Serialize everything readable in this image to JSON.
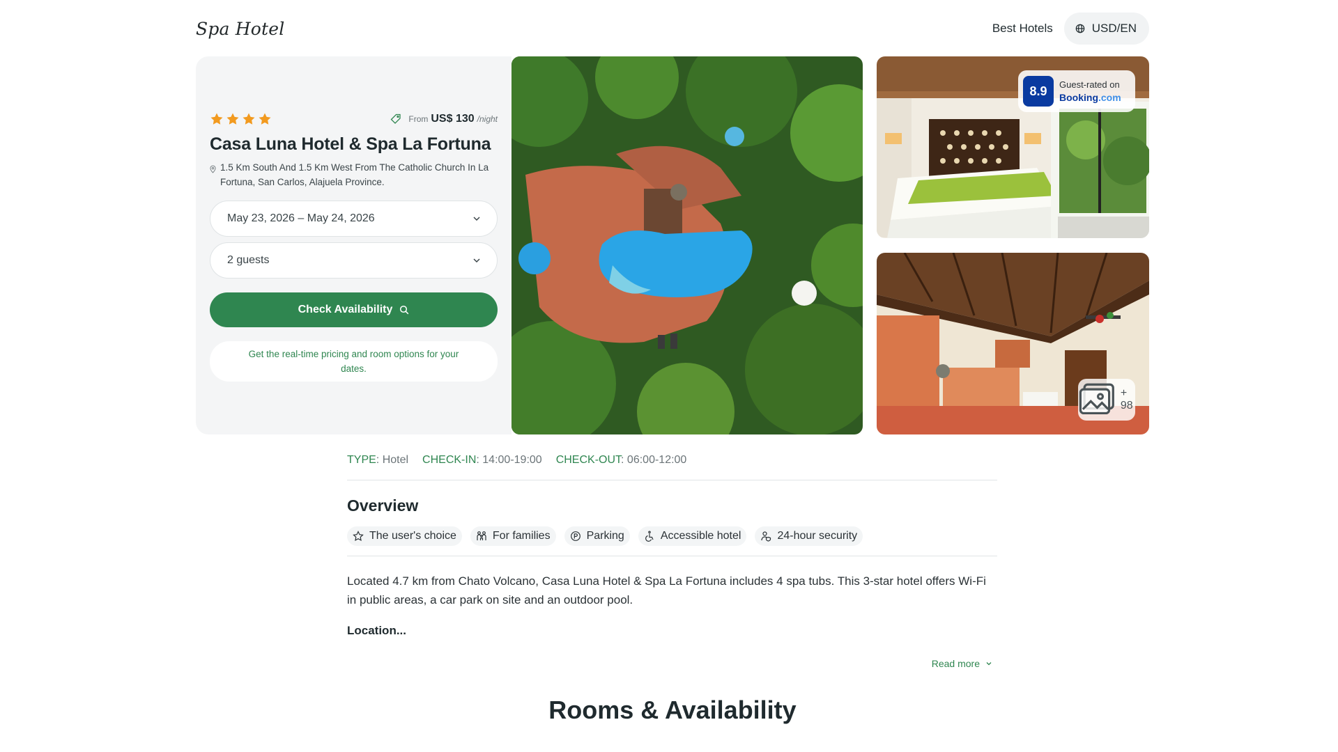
{
  "header": {
    "logo": "Spa Hotel",
    "nav_link": "Best Hotels",
    "currency": "USD/EN"
  },
  "hotel": {
    "stars": 4,
    "price_from": "From",
    "price": "US$ 130",
    "price_unit": "/night",
    "name": "Casa Luna Hotel & Spa La Fortuna",
    "address": "1.5 Km South And 1.5 Km West From The Catholic Church In La Fortuna, San Carlos, Alajuela Province."
  },
  "booking": {
    "dates": "May 23, 2026 – May 24, 2026",
    "guests": "2 guests",
    "cta": "Check Availability",
    "hint": "Get the real-time pricing and room options for your dates."
  },
  "gallery": {
    "score": "8.9",
    "score_label": "Guest-rated on",
    "score_brand": "Booking",
    "score_brand_suffix": ".com",
    "more_count": "+ 98"
  },
  "meta": {
    "type_label": "TYPE",
    "type_value": "Hotel",
    "checkin_label": "CHECK-IN",
    "checkin_value": "14:00-19:00",
    "checkout_label": "CHECK-OUT",
    "checkout_value": "06:00-12:00"
  },
  "overview": {
    "title": "Overview",
    "chips": [
      {
        "label": "The user's choice",
        "icon": "star-outline-icon"
      },
      {
        "label": "For families",
        "icon": "family-icon"
      },
      {
        "label": "Parking",
        "icon": "parking-icon"
      },
      {
        "label": "Accessible hotel",
        "icon": "wheelchair-icon"
      },
      {
        "label": "24-hour security",
        "icon": "security-icon"
      }
    ],
    "description": "Located 4.7 km from Chato Volcano, Casa Luna Hotel & Spa La Fortuna includes 4 spa tubs. This 3-star hotel offers Wi-Fi in public areas, a car park on site and an outdoor pool.",
    "location_heading": "Location...",
    "read_more": "Read more"
  },
  "rooms": {
    "title": "Rooms & Availability"
  },
  "colors": {
    "accent_green": "#2f8650",
    "star_orange": "#f29a1f",
    "booking_blue": "#0a3aa0"
  }
}
